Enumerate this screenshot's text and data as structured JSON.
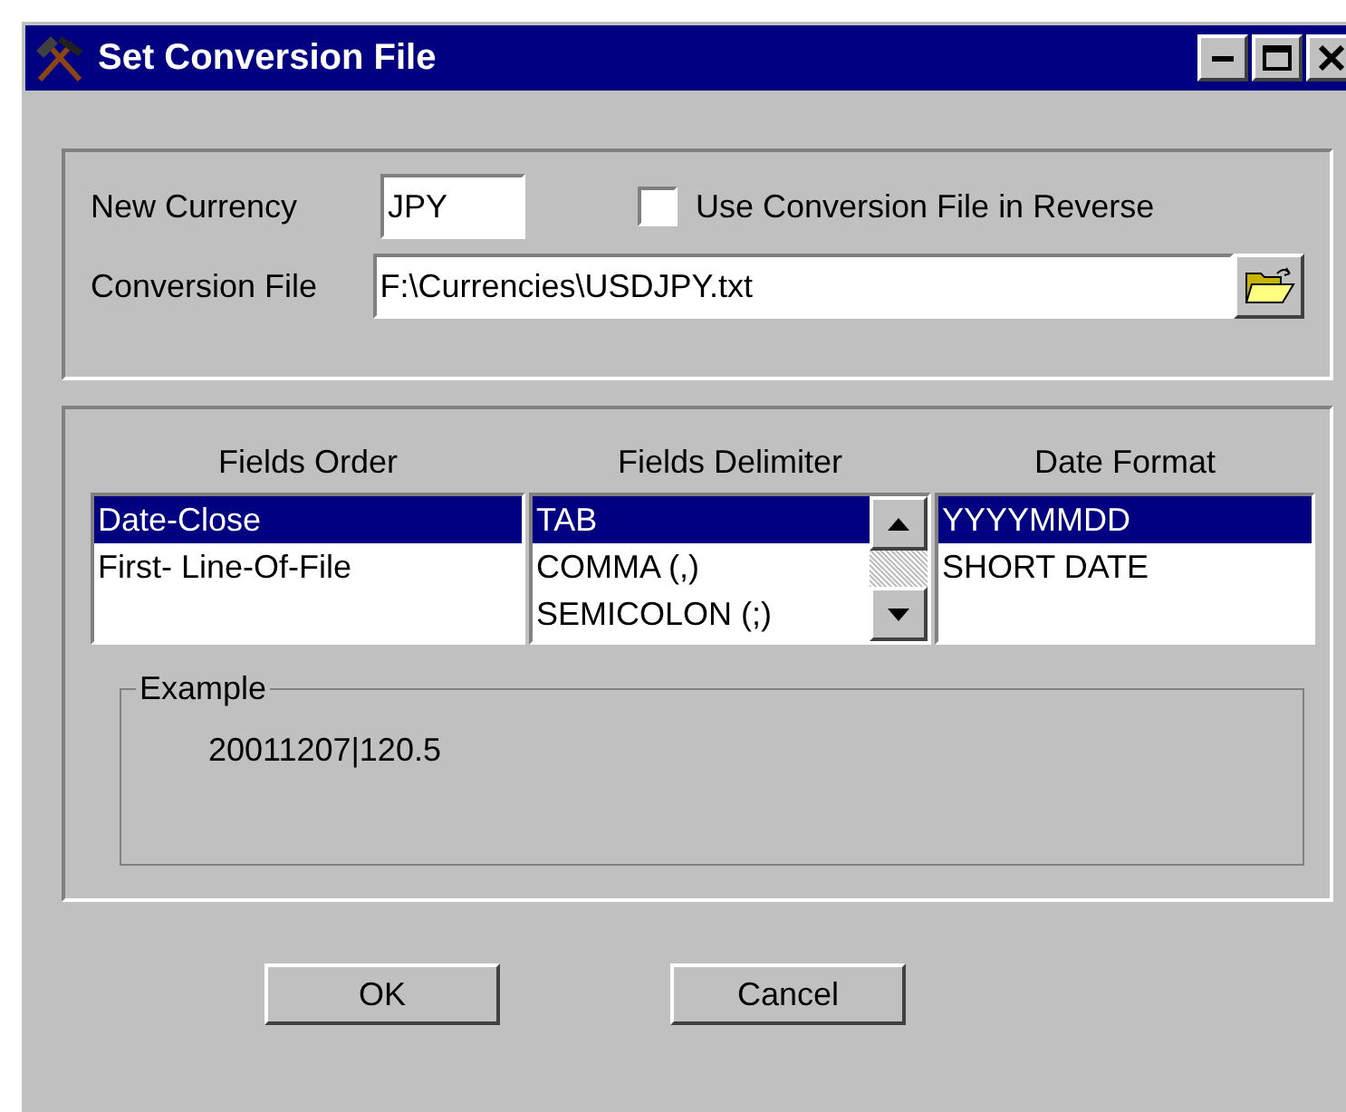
{
  "window": {
    "title": "Set Conversion File"
  },
  "new_currency": {
    "label": "New Currency",
    "value": "JPY"
  },
  "reverse": {
    "label": "Use Conversion File in Reverse",
    "checked": false
  },
  "conversion_file": {
    "label": "Conversion File",
    "value": "F:\\Currencies\\USDJPY.txt"
  },
  "lists": [
    {
      "heading": "Fields Order",
      "scroll": false,
      "items": [
        {
          "label": "Date-Close",
          "selected": true
        },
        {
          "label": "First- Line-Of-File",
          "selected": false
        }
      ]
    },
    {
      "heading": "Fields Delimiter",
      "scroll": true,
      "items": [
        {
          "label": "TAB",
          "selected": true
        },
        {
          "label": "COMMA (,)",
          "selected": false
        },
        {
          "label": "SEMICOLON (;)",
          "selected": false
        }
      ]
    },
    {
      "heading": "Date Format",
      "scroll": false,
      "items": [
        {
          "label": "YYYYMMDD",
          "selected": true
        },
        {
          "label": "SHORT DATE",
          "selected": false
        }
      ]
    }
  ],
  "example": {
    "legend": "Example",
    "text": "20011207|120.5"
  },
  "buttons": [
    "OK",
    "Cancel"
  ]
}
